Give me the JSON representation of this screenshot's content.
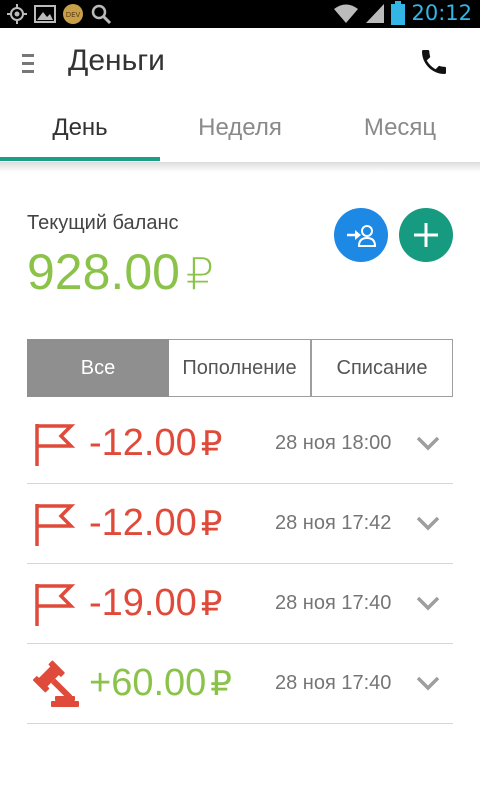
{
  "status_bar": {
    "time": "20:12",
    "left_icons": [
      "gps-icon",
      "image-icon",
      "dev-icon",
      "search-icon"
    ],
    "right_icons": [
      "wifi-icon",
      "signal-icon",
      "battery-icon"
    ],
    "dev_badge": "DEV"
  },
  "appbar": {
    "title": "Деньги",
    "menu_icon": "menu-icon",
    "action_icon": "phone-icon"
  },
  "tabs": [
    {
      "label": "День",
      "active": true
    },
    {
      "label": "Неделя",
      "active": false
    },
    {
      "label": "Месяц",
      "active": false
    }
  ],
  "balance": {
    "label": "Текущий баланс",
    "amount": "928.00",
    "currency": "₽"
  },
  "actions": {
    "transfer_icon": "transfer-user-icon",
    "add_icon": "plus-icon"
  },
  "filter": {
    "options": [
      "Все",
      "Пополнение",
      "Списание"
    ],
    "selected": "Все"
  },
  "transactions": [
    {
      "amount": "-12.00",
      "currency": "₽",
      "date": "28 ноя 18:00",
      "type": "flag-icon",
      "kind": "negative"
    },
    {
      "amount": "-12.00",
      "currency": "₽",
      "date": "28 ноя 17:42",
      "type": "flag-icon",
      "kind": "negative"
    },
    {
      "amount": "-19.00",
      "currency": "₽",
      "date": "28 ноя 17:40",
      "type": "flag-icon",
      "kind": "negative"
    },
    {
      "amount": "+60.00",
      "currency": "₽",
      "date": "28 ноя 17:40",
      "type": "gavel-icon",
      "kind": "positive"
    }
  ],
  "colors": {
    "accent": "#1b9e87",
    "positive": "#8bc34a",
    "negative": "#e04a3a",
    "transfer_button": "#1e88e5",
    "add_button": "#169a80"
  }
}
